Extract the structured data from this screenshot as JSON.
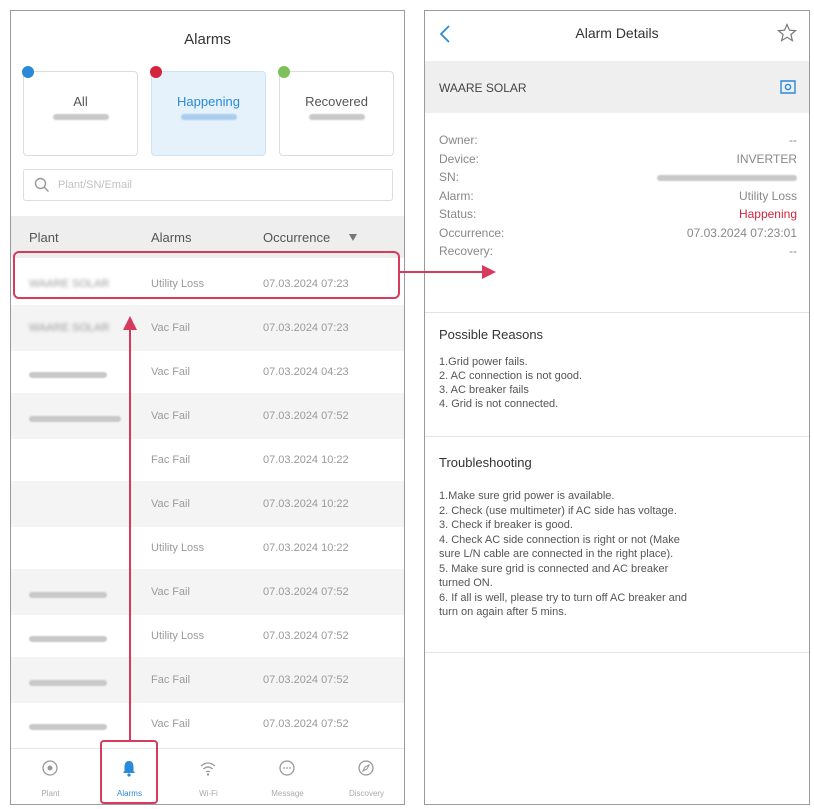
{
  "colors": {
    "accent": "#2a8ad8",
    "highlight": "#d63a5c",
    "happening": "#d3263d",
    "all_dot": "#2a8ad8",
    "happening_dot": "#d3263d",
    "recovered_dot": "#7cc25a"
  },
  "list": {
    "title": "Alarms",
    "cards": [
      {
        "label": "All"
      },
      {
        "label": "Happening"
      },
      {
        "label": "Recovered"
      }
    ],
    "search_placeholder": "Plant/SN/Email",
    "headers": {
      "plant": "Plant",
      "alarm": "Alarms",
      "occurrence": "Occurrence"
    },
    "sort_icon": "sort-down-icon",
    "rows": [
      {
        "plant": "WAARE SOLAR",
        "alarm": "Utility Loss",
        "time": "07.03.2024 07:23"
      },
      {
        "plant": "WAARE SOLAR",
        "alarm": "Vac Fail",
        "time": "07.03.2024 07:23"
      },
      {
        "plant": "",
        "alarm": "Vac Fail",
        "time": "07.03.2024 04:23"
      },
      {
        "plant": "",
        "alarm": "Vac Fail",
        "time": "07.03.2024 07:52"
      },
      {
        "plant": "",
        "alarm": "Fac Fail",
        "time": "07.03.2024 10:22"
      },
      {
        "plant": "",
        "alarm": "Vac Fail",
        "time": "07.03.2024 10:22"
      },
      {
        "plant": "",
        "alarm": "Utility Loss",
        "time": "07.03.2024 10:22"
      },
      {
        "plant": "",
        "alarm": "Vac Fail",
        "time": "07.03.2024 07:52"
      },
      {
        "plant": "",
        "alarm": "Utility Loss",
        "time": "07.03.2024 07:52"
      },
      {
        "plant": "",
        "alarm": "Fac Fail",
        "time": "07.03.2024 07:52"
      },
      {
        "plant": "",
        "alarm": "Vac Fail",
        "time": "07.03.2024 07:52"
      }
    ],
    "tabs": [
      {
        "label": "Plant",
        "icon": "plant-icon"
      },
      {
        "label": "Alarms",
        "icon": "bell-icon"
      },
      {
        "label": "Wi-Fi",
        "icon": "wifi-icon"
      },
      {
        "label": "Message",
        "icon": "message-icon"
      },
      {
        "label": "Discovery",
        "icon": "compass-icon"
      }
    ]
  },
  "detail": {
    "title": "Alarm Details",
    "plant_name": "WAARE SOLAR",
    "fields": [
      {
        "key": "Owner:",
        "value": "--"
      },
      {
        "key": "Device:",
        "value": "INVERTER"
      },
      {
        "key": "SN:",
        "value": ""
      },
      {
        "key": "Alarm:",
        "value": "Utility Loss"
      },
      {
        "key": "Status:",
        "value": "Happening"
      },
      {
        "key": "Occurrence:",
        "value": "07.03.2024 07:23:01"
      },
      {
        "key": "Recovery:",
        "value": "--"
      }
    ],
    "reasons_title": "Possible Reasons",
    "reasons": [
      "1.Grid power fails.",
      "2. AC connection is not good.",
      "3. AC breaker fails",
      "4. Grid is not connected."
    ],
    "troubleshooting_title": "Troubleshooting",
    "troubleshooting": [
      "1.Make sure grid power is available.",
      "2. Check (use multimeter) if AC side has voltage.",
      "3. Check if breaker is good.",
      "4. Check AC side connection is right or not (Make",
      "sure L/N cable are connected in the right place).",
      "5. Make sure grid is connected and AC breaker",
      "turned ON.",
      "6. If all is well, please try to turn off AC breaker and",
      "turn on again after 5 mins."
    ]
  }
}
